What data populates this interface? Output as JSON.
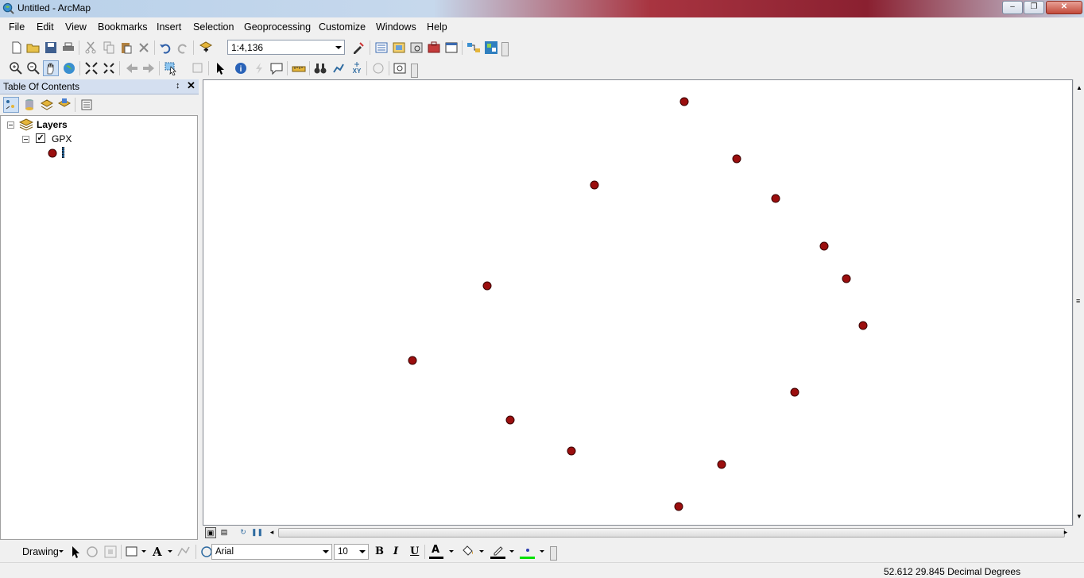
{
  "window": {
    "title": "Untitled - ArcMap",
    "min_label": "–",
    "max_label": "❐",
    "close_label": "✕"
  },
  "menu": [
    "File",
    "Edit",
    "View",
    "Bookmarks",
    "Insert",
    "Selection",
    "Geoprocessing",
    "Customize",
    "Windows",
    "Help"
  ],
  "standard_toolbar": {
    "scale": "1:4,136"
  },
  "toc": {
    "title": "Table Of Contents",
    "pin_label": "↕",
    "close_label": "✕",
    "data_frame": "Layers",
    "layer": {
      "name": "GPX",
      "checked": true,
      "symbol_color": "#9b0e0e"
    }
  },
  "map": {
    "point_color": "#9b0e0e",
    "point_count": 15
  },
  "drawing_toolbar": {
    "drawing_label": "Drawing",
    "font_name": "Arial",
    "font_size": "10",
    "bold": "B",
    "italic": "I",
    "underline": "U",
    "font_color_letter": "A",
    "text_color": "#000000",
    "fill_color": "#ffd700",
    "line_color": "#000000",
    "marker_color": "#00e000"
  },
  "status": {
    "coordinates": "52.612  29.845 Decimal Degrees"
  }
}
